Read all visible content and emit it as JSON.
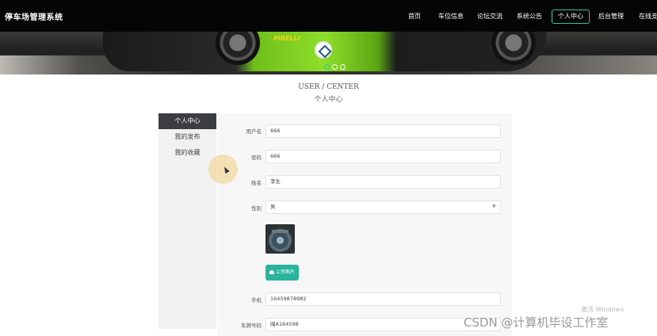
{
  "brand": "停车场管理系统",
  "nav": [
    {
      "label": "首页"
    },
    {
      "label": "车位信息"
    },
    {
      "label": "论坛交流"
    },
    {
      "label": "系统公告"
    },
    {
      "label": "个人中心",
      "active": true
    },
    {
      "label": "后台管理"
    },
    {
      "label": "在线支"
    }
  ],
  "banner": {
    "brand_text": "PIRELLI",
    "slides": 3,
    "active_slide": 1
  },
  "heading": {
    "en": "USER / CENTER",
    "cn": "个人中心"
  },
  "sidebar": {
    "items": [
      {
        "label": "个人中心",
        "active": true
      },
      {
        "label": "我的发布"
      },
      {
        "label": "我的收藏"
      }
    ]
  },
  "form": {
    "username": {
      "label": "用户名",
      "value": "666"
    },
    "password": {
      "label": "密码",
      "value": "666"
    },
    "name": {
      "label": "姓名",
      "value": "李生"
    },
    "gender": {
      "label": "性别",
      "value": "男"
    },
    "upload_label": "上传图片",
    "phone": {
      "label": "手机",
      "value": "16459878982"
    },
    "plate": {
      "label": "车牌号码",
      "value": "闽A164598"
    }
  },
  "overlays": {
    "windows": "激活 Windows",
    "watermark": "CSDN @计算机毕设工作室"
  },
  "colors": {
    "accent": "#2ab49e",
    "nav_bg": "#050505",
    "sidebar_active": "#3a3d42"
  }
}
